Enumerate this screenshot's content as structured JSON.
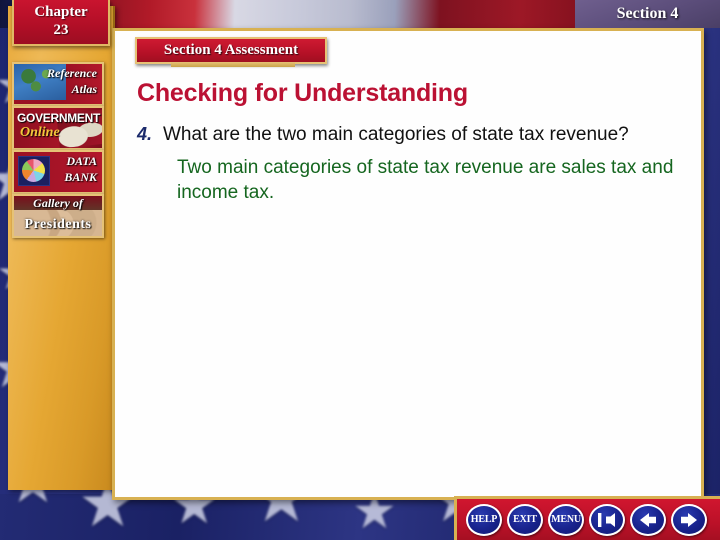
{
  "header": {
    "chapter_label": "Chapter",
    "chapter_number": "23",
    "section_tab": "Section 4"
  },
  "sidebar": {
    "items": [
      {
        "name": "reference-atlas",
        "line1": "Reference",
        "line2": "Atlas",
        "icon": "globe-map-icon"
      },
      {
        "name": "government-online",
        "line1": "GOVERNMENT",
        "line2": "Online",
        "icon": "open-book-mouse-icon"
      },
      {
        "name": "data-bank",
        "line1": "DATA",
        "line2": "BANK",
        "icon": "pie-chart-icon"
      },
      {
        "name": "gallery-of-presidents",
        "line1": "Gallery of",
        "line2": "Presidents",
        "icon": "president-portraits-icon"
      }
    ]
  },
  "content": {
    "assessment_banner": "Section 4 Assessment",
    "heading": "Checking for Understanding",
    "question_number": "4.",
    "question_text": "What are the two main categories of state tax revenue?",
    "answer_text": "Two main categories of state tax revenue are sales tax and income tax."
  },
  "navbar": {
    "buttons": [
      {
        "name": "help-button",
        "label": "HELP",
        "icon": ""
      },
      {
        "name": "exit-button",
        "label": "EXIT",
        "icon": ""
      },
      {
        "name": "menu-button",
        "label": "MENU",
        "icon": ""
      },
      {
        "name": "first-slide-button",
        "label": "",
        "icon": "arrow-left-bar-icon"
      },
      {
        "name": "previous-slide-button",
        "label": "",
        "icon": "arrow-left-icon"
      },
      {
        "name": "next-slide-button",
        "label": "",
        "icon": "arrow-right-icon"
      }
    ]
  },
  "colors": {
    "crimson": "#bb1133",
    "gold": "#d8b152",
    "navy": "#1b2a6b",
    "green": "#15661f",
    "sidebar_gold": "#e8aa3c"
  }
}
